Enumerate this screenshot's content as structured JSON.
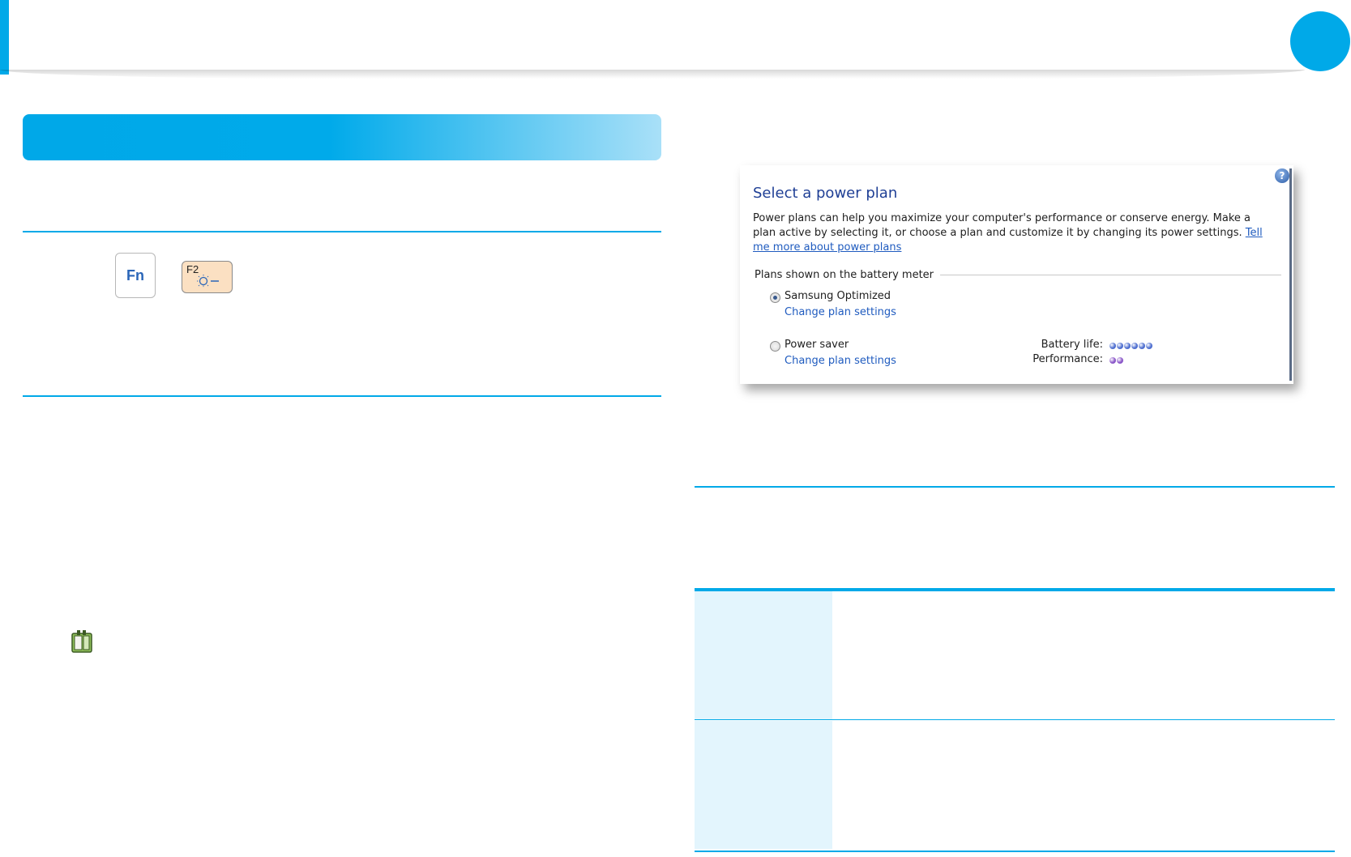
{
  "theme": {
    "accent": "#00a9e8",
    "table_label_bg": "#e3f5fd",
    "key_f2_bg": "#fbe0c2"
  },
  "keys": {
    "fn": "Fn",
    "f2": "F2",
    "f2_icon": "brightness-down-icon"
  },
  "icons": {
    "battery": "battery-plug-icon"
  },
  "dialog": {
    "help": "?",
    "title": "Select a power plan",
    "desc_text": "Power plans can help you maximize your computer's performance or conserve energy. Make a plan active by selecting it, or choose a plan and customize it by changing its power settings. ",
    "desc_link": "Tell me more about power plans",
    "group_label": "Plans shown on the battery meter",
    "plans": [
      {
        "name": "Samsung Optimized",
        "link": "Change plan settings",
        "selected": true
      },
      {
        "name": "Power saver",
        "link": "Change plan settings",
        "selected": false
      }
    ],
    "metrics": {
      "battery_life_label": "Battery life:",
      "battery_life_level": 6,
      "performance_label": "Performance:",
      "performance_level": 2,
      "battery_color": "#4f6fd0",
      "performance_color": "#8a56c8"
    }
  }
}
